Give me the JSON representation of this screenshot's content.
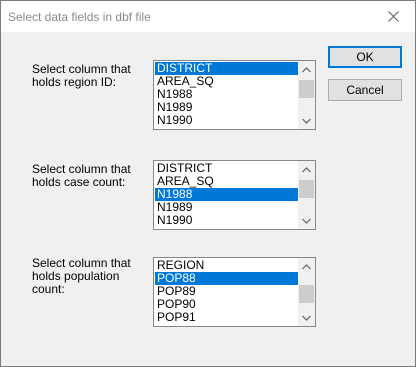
{
  "dialog": {
    "title": "Select data fields in dbf file",
    "ok_label": "OK",
    "cancel_label": "Cancel"
  },
  "region": {
    "label": "Select column that holds region ID:",
    "items": [
      "DISTRICT",
      "AREA_SQ",
      "N1988",
      "N1989",
      "N1990"
    ],
    "selected": "DISTRICT"
  },
  "cases": {
    "label": "Select column that holds case count:",
    "items": [
      "DISTRICT",
      "AREA_SQ",
      "N1988",
      "N1989",
      "N1990"
    ],
    "selected": "N1988"
  },
  "population": {
    "label": "Select column that holds population count:",
    "items": [
      "REGION",
      "POP88",
      "POP89",
      "POP90",
      "POP91"
    ],
    "selected": "POP88"
  },
  "colors": {
    "selection": "#0078d7",
    "window_bg": "#f0f0f0"
  }
}
